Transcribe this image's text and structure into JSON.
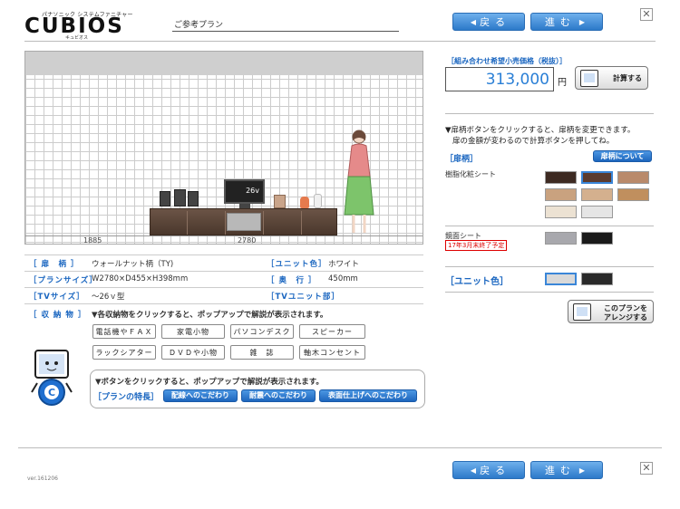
{
  "header": {
    "logo_top": "パナソニック システムファニチャー",
    "logo": "CUBIOS",
    "logo_sub": "キュビオス",
    "plan_label": "ご参考プラン",
    "back_label": "戻る",
    "next_label": "進む",
    "close": "✕"
  },
  "preview": {
    "tv_size": "26v",
    "dim_left": "1885",
    "dim_center": "2780"
  },
  "info": {
    "pattern_key": "［ 扉　柄 ］",
    "pattern_val": "ウォールナット柄（TY)",
    "unit_color_key": "［ユニット色］",
    "unit_color_val": "ホワイト",
    "plan_size_key": "［プランサイズ］",
    "plan_size_val": "W2780×D455×H398mm",
    "depth_key": "［ 奥　行 ］",
    "depth_val": "450mm",
    "tv_size_key": "［TVサイズ］",
    "tv_size_val": "～26ｖ型",
    "tv_unit_key": "［TVユニット部］",
    "storage_key": "［ 収 納 物 ］",
    "storage_note": "▼各収納物をクリックすると、ポップアップで解説が表示されます。",
    "storage_items": [
      "電話機やＦＡＸ",
      "家電小物",
      "パソコンデスク",
      "スピーカー",
      "ラックシアター",
      "ＤＶＤや小物",
      "雑　誌",
      "軸木コンセント"
    ]
  },
  "bubble": {
    "note": "▼ボタンをクリックすると、ポップアップで解説が表示されます。",
    "features_label": "［プランの特長］",
    "features": [
      "配線へのこだわり",
      "耐震へのこだわり",
      "表面仕上げへのこだわり"
    ]
  },
  "side": {
    "price_title": "［組み合わせ希望小売価格（税抜）］",
    "price": "313,000",
    "yen": "円",
    "calc_label": "計算する",
    "note_line1": "▼扉柄ボタンをクリックすると、扉柄を変更できます。",
    "note_line2": "扉の金額が変わるので計算ボタンを押してね。",
    "pattern_title": "［扉柄］",
    "pattern_about": "扉柄について",
    "resin_label": "樹脂化粧シート",
    "mirror_label": "鏡面シート",
    "mirror_note": "17年3月末終了予定",
    "unit_color_title": "［ユニット色］",
    "arrange_line1": "このプランを",
    "arrange_line2": "アレンジする"
  },
  "colors": {
    "accent": "#1a66c0",
    "nav_blue": "#2c79c9",
    "resin_swatches": [
      "#3d2a22",
      "#5b3b2e",
      "#b98a6b",
      "#c9a27f",
      "#d4b08e",
      "#c08f5e",
      "#ece2d3",
      "#e5e5e5",
      "#f2ece3"
    ],
    "mirror_swatches": [
      "#a8a8ad",
      "#1a1a1a"
    ],
    "unit_swatches": [
      "#d9d9d9",
      "#2a2a2a"
    ]
  },
  "footer": {
    "version": "ver.161206"
  }
}
